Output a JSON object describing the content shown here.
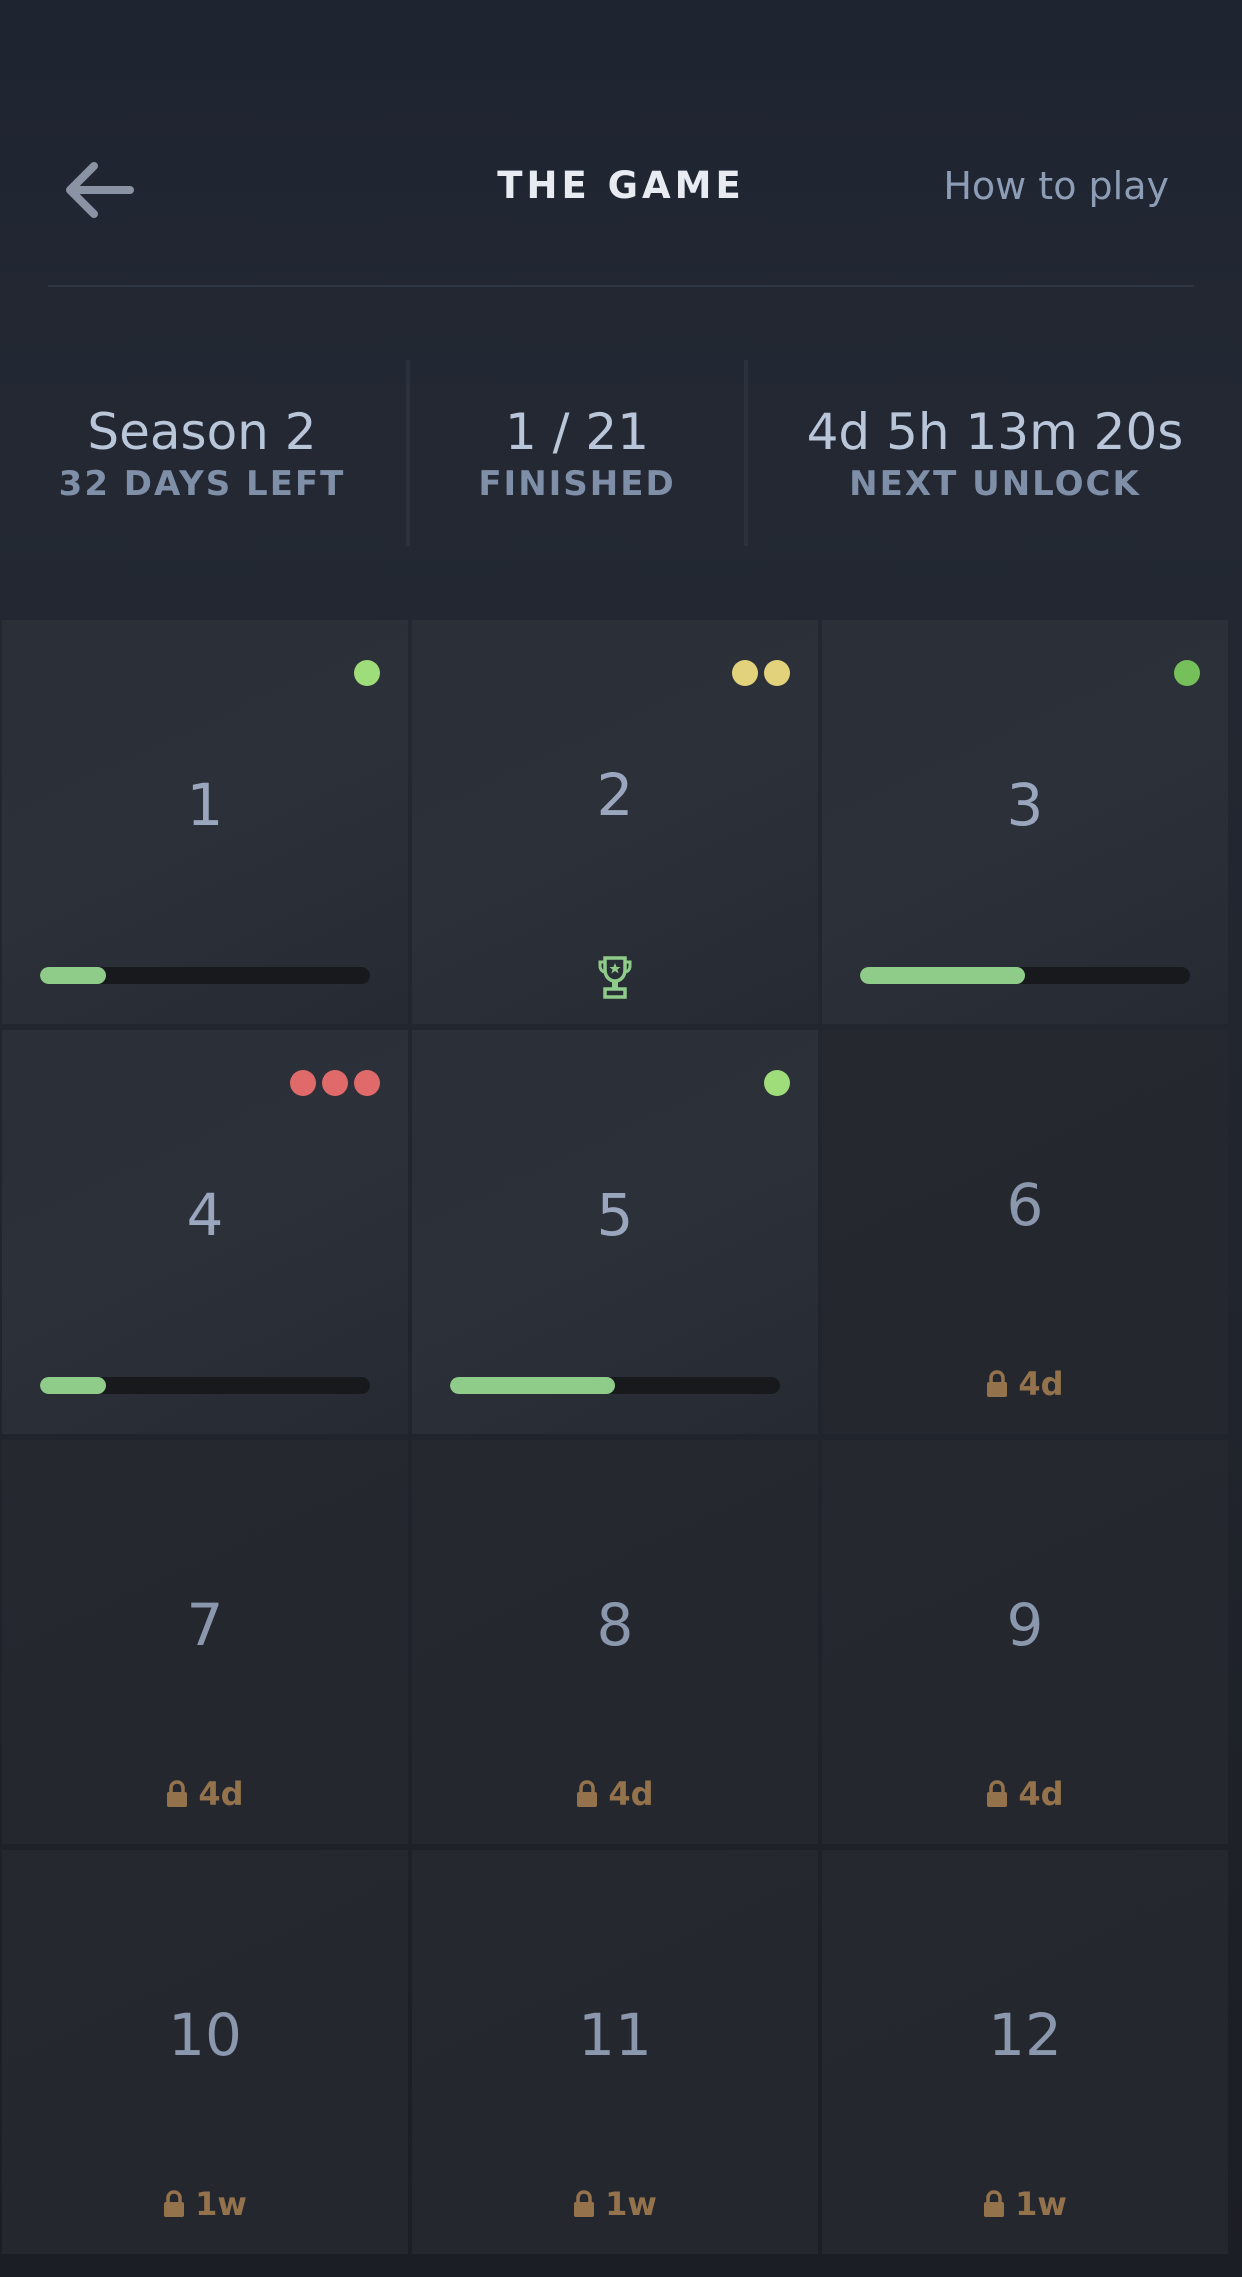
{
  "header": {
    "title": "THE GAME",
    "how_to_play": "How to play"
  },
  "stats": {
    "season": {
      "value": "Season 2",
      "label": "32 DAYS LEFT"
    },
    "finished": {
      "value": "1 / 21",
      "label": "FINISHED"
    },
    "unlock": {
      "value": "4d 5h 13m 20s",
      "label": "NEXT UNLOCK"
    }
  },
  "colors": {
    "accent_green": "#8fcc8a",
    "dot_green_light": "#9fdc7a",
    "dot_green": "#75c05a",
    "dot_yellow": "#e2d27c",
    "dot_red": "#e06a6a",
    "lock_brown": "#94734c"
  },
  "levels": [
    {
      "number": "1",
      "state": "open",
      "progress": 0.2,
      "dots": [
        "dot_green_light"
      ]
    },
    {
      "number": "2",
      "state": "completed",
      "trophy": true,
      "dots": [
        "dot_yellow",
        "dot_yellow"
      ]
    },
    {
      "number": "3",
      "state": "open",
      "progress": 0.5,
      "dots": [
        "dot_green"
      ]
    },
    {
      "number": "4",
      "state": "open",
      "progress": 0.2,
      "dots": [
        "dot_red",
        "dot_red",
        "dot_red"
      ]
    },
    {
      "number": "5",
      "state": "open",
      "progress": 0.5,
      "dots": [
        "dot_green_light"
      ]
    },
    {
      "number": "6",
      "state": "locked",
      "lock_text": "4d"
    },
    {
      "number": "7",
      "state": "locked",
      "lock_text": "4d"
    },
    {
      "number": "8",
      "state": "locked",
      "lock_text": "4d"
    },
    {
      "number": "9",
      "state": "locked",
      "lock_text": "4d"
    },
    {
      "number": "10",
      "state": "locked",
      "lock_text": "1w"
    },
    {
      "number": "11",
      "state": "locked",
      "lock_text": "1w"
    },
    {
      "number": "12",
      "state": "locked",
      "lock_text": "1w"
    }
  ]
}
